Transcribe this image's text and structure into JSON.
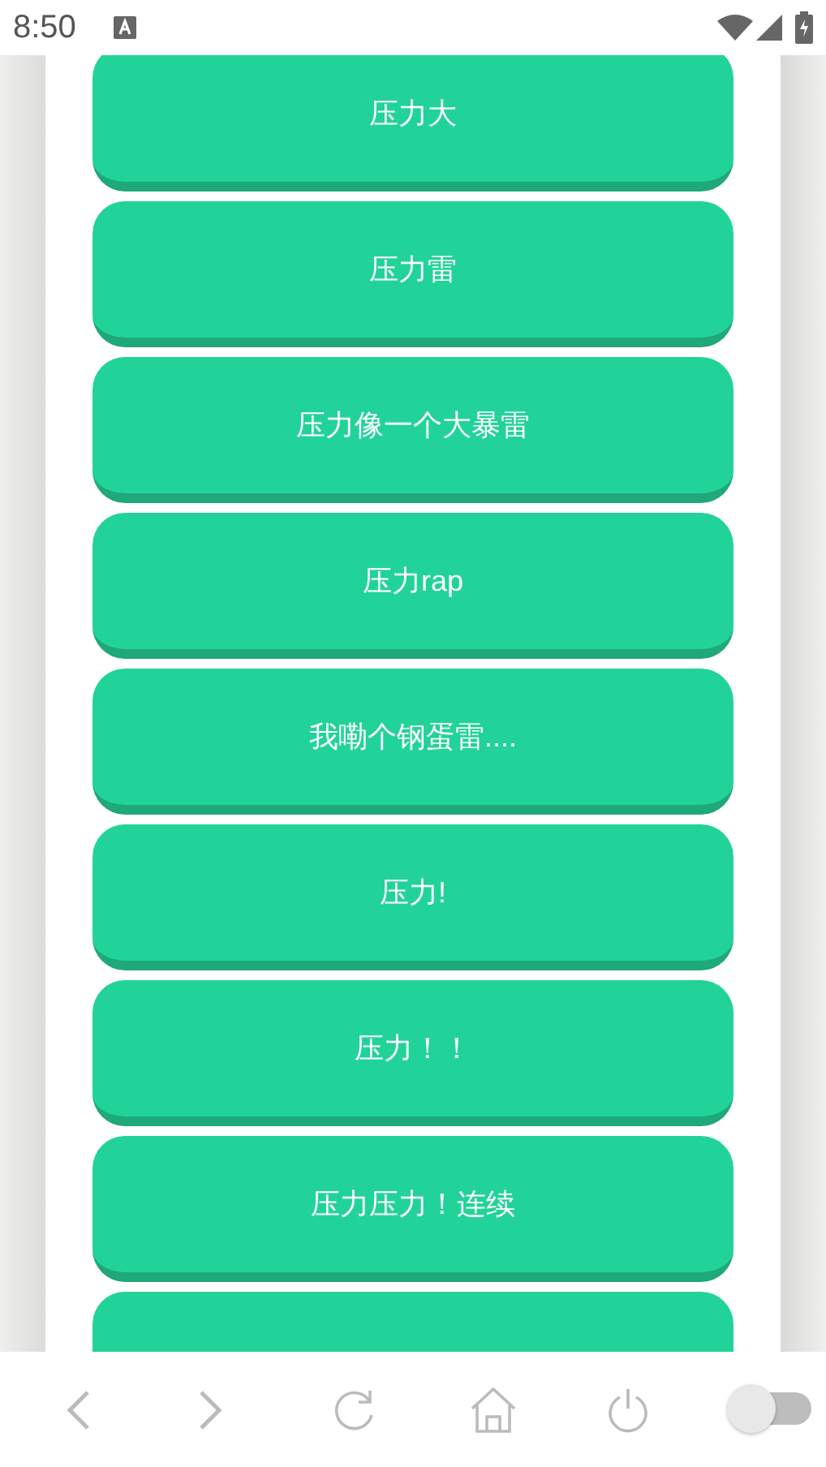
{
  "status_bar": {
    "time": "8:50"
  },
  "buttons": [
    {
      "kind": "labeled",
      "label": "压力大"
    },
    {
      "kind": "labeled",
      "label": "压力雷"
    },
    {
      "kind": "labeled",
      "label": "压力像一个大暴雷"
    },
    {
      "kind": "labeled",
      "label": "压力rap"
    },
    {
      "kind": "labeled",
      "label": "我嘞个钢蛋雷...."
    },
    {
      "kind": "labeled",
      "label": "压力!"
    },
    {
      "kind": "labeled",
      "label": "压力！！"
    },
    {
      "kind": "labeled",
      "label": "压力压力！连续"
    },
    {
      "kind": "covered"
    }
  ],
  "toolbar": {
    "toggle": {
      "on": false
    }
  }
}
